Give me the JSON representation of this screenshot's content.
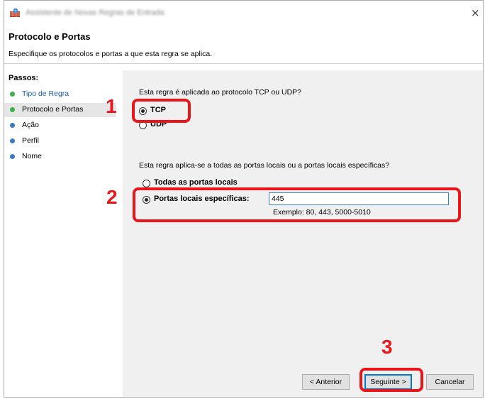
{
  "window": {
    "title": "Assistente de Novas Regras de Entrada",
    "close_glyph": "×"
  },
  "header": {
    "title": "Protocolo e Portas",
    "subtitle": "Especifique os protocolos e portas a que esta regra se aplica."
  },
  "steps": {
    "title": "Passos:",
    "items": [
      {
        "label": "Tipo de Regra",
        "state": "completed"
      },
      {
        "label": "Protocolo e Portas",
        "state": "current"
      },
      {
        "label": "Ação",
        "state": "pending"
      },
      {
        "label": "Perfil",
        "state": "pending"
      },
      {
        "label": "Nome",
        "state": "pending"
      }
    ]
  },
  "protocol": {
    "question": "Esta regra é aplicada ao protocolo TCP ou UDP?",
    "options": [
      {
        "label": "TCP",
        "checked": true
      },
      {
        "label": "UDP",
        "checked": false
      }
    ]
  },
  "ports": {
    "question": "Esta regra aplica-se a todas as portas locais ou a portas locais específicas?",
    "options": [
      {
        "label": "Todas as portas locais",
        "checked": false
      },
      {
        "label": "Portas locais específicas:",
        "checked": true
      }
    ],
    "value": "445",
    "example": "Exemplo: 80, 443, 5000-5010"
  },
  "buttons": {
    "back": "< Anterior",
    "next": "Seguinte >",
    "cancel": "Cancelar"
  },
  "annotations": {
    "step1": "1",
    "step2": "2",
    "step3": "3"
  },
  "colors": {
    "highlight": "#e8161b",
    "dot_green": "#3cb34a",
    "dot_blue": "#3a78c9",
    "link_blue": "#1a5fb4",
    "panel_bg": "#f0f0f0"
  }
}
